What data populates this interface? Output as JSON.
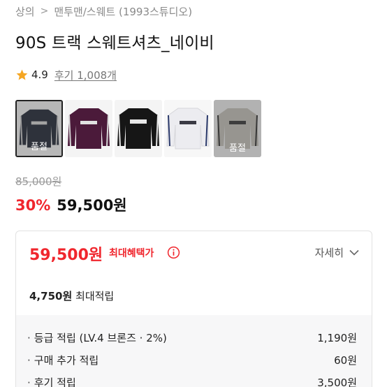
{
  "breadcrumb": {
    "items": [
      "상의",
      "맨투맨/스웨트 (1993스튜디오)"
    ]
  },
  "product": {
    "title": "90S 트랙 스웨트셔츠_네이비",
    "rating": "4.9",
    "reviews_label": "후기 1,008개"
  },
  "thumbnails": [
    {
      "color": "navy",
      "selected": true,
      "soldout_label": "품절"
    },
    {
      "color": "purple",
      "selected": false,
      "soldout_label": ""
    },
    {
      "color": "black",
      "selected": false,
      "soldout_label": ""
    },
    {
      "color": "white",
      "selected": false,
      "soldout_label": ""
    },
    {
      "color": "gray",
      "selected": false,
      "soldout_label": "품절"
    }
  ],
  "pricing": {
    "original_price": "85,000원",
    "discount": "30%",
    "sale_price": "59,500원"
  },
  "benefit": {
    "price": "59,500원",
    "label": "최대혜택가",
    "detail_button": "자세히",
    "max_point_amount": "4,750원",
    "max_point_label": " 최대적립",
    "items": [
      {
        "label": "등급 적립 (LV.4 브론즈 · 2%)",
        "value": "1,190원"
      },
      {
        "label": "구매 추가 적립",
        "value": "60원"
      },
      {
        "label": "후기 적립",
        "value": "3,500원"
      }
    ]
  },
  "colors": {
    "accent_red": "#f0262d",
    "star": "#f5a623"
  },
  "icons": [
    "chevron-right-icon",
    "star-icon",
    "info-icon",
    "chevron-down-icon"
  ]
}
